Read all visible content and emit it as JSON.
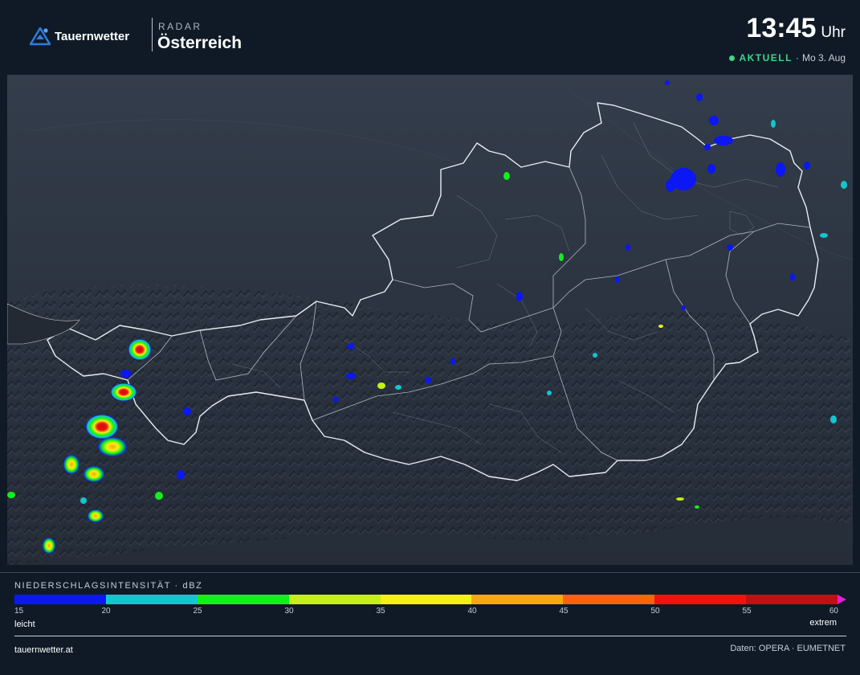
{
  "brand": {
    "name": "Tauernwetter",
    "logo_icon": "mountain-triangle-icon",
    "accent": "#2f7de1"
  },
  "header": {
    "kicker": "RADAR",
    "region": "Österreich"
  },
  "clock": {
    "time": "13:45",
    "unit": "Uhr"
  },
  "status": {
    "live_label": "AKTUELL",
    "separator": "·",
    "date": "Mo 3. Aug",
    "live_color": "#3ed68a"
  },
  "legend": {
    "title": "NIEDERSCHLAGSINTENSITÄT · dBZ",
    "colors": [
      "#0b17f4",
      "#13c6ce",
      "#12f01a",
      "#c5f012",
      "#f4f00f",
      "#f7a90b",
      "#f8640b",
      "#f5100f",
      "#c30f13"
    ],
    "overflow_color": "#e21fd3",
    "ticks": [
      "15",
      "20",
      "25",
      "30",
      "35",
      "40",
      "45",
      "50",
      "55",
      "60"
    ],
    "low_label": "leicht",
    "high_label": "extrem"
  },
  "footer": {
    "site": "tauernwetter.at",
    "credits": "Daten: OPERA · EUMETNET"
  }
}
